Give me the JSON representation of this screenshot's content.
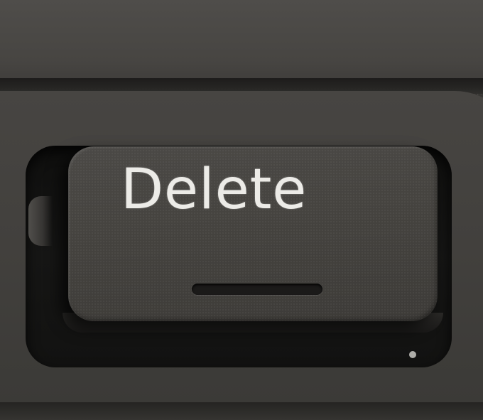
{
  "key": {
    "legend": "Delete"
  },
  "colors": {
    "keycap": "#45433f",
    "legend": "#ecebe7",
    "key_well": "#121211",
    "keyboard_deck": "#42403d"
  }
}
